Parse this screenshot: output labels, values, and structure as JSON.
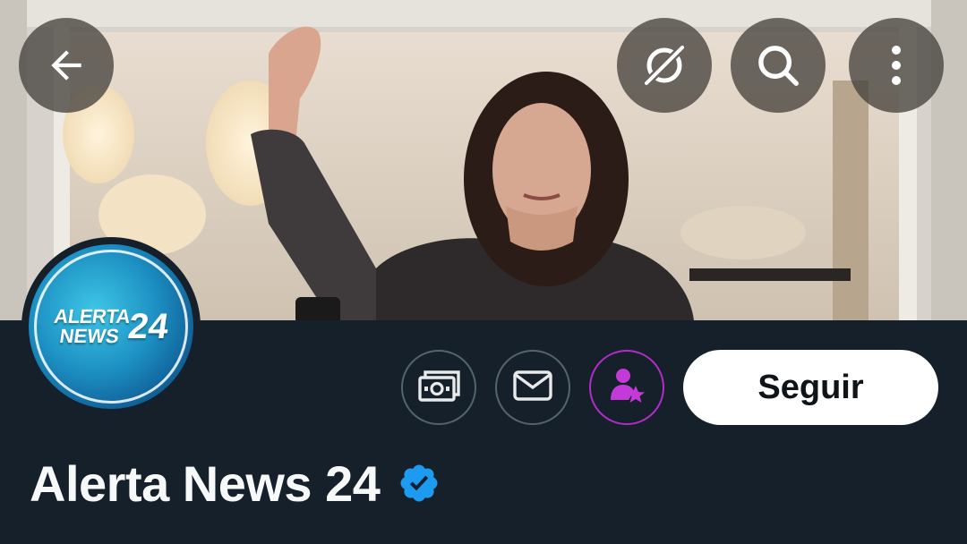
{
  "header": {
    "back_icon": "arrow-left-icon",
    "grok_icon": "grok-icon",
    "search_icon": "search-icon",
    "more_icon": "more-vertical-icon"
  },
  "profile": {
    "display_name": "Alerta News 24",
    "verified": true,
    "avatar_text": {
      "line1": "ALERTA",
      "line2": "NEWS",
      "number": "24"
    }
  },
  "actions": {
    "tip_icon": "money-icon",
    "message_icon": "envelope-icon",
    "subscribe_icon": "person-star-icon",
    "follow_label": "Seguir"
  },
  "colors": {
    "background": "#15202b",
    "verified_blue": "#1d9bf0",
    "subscribe_purple": "#b02dc7",
    "follow_bg": "#ffffff"
  }
}
